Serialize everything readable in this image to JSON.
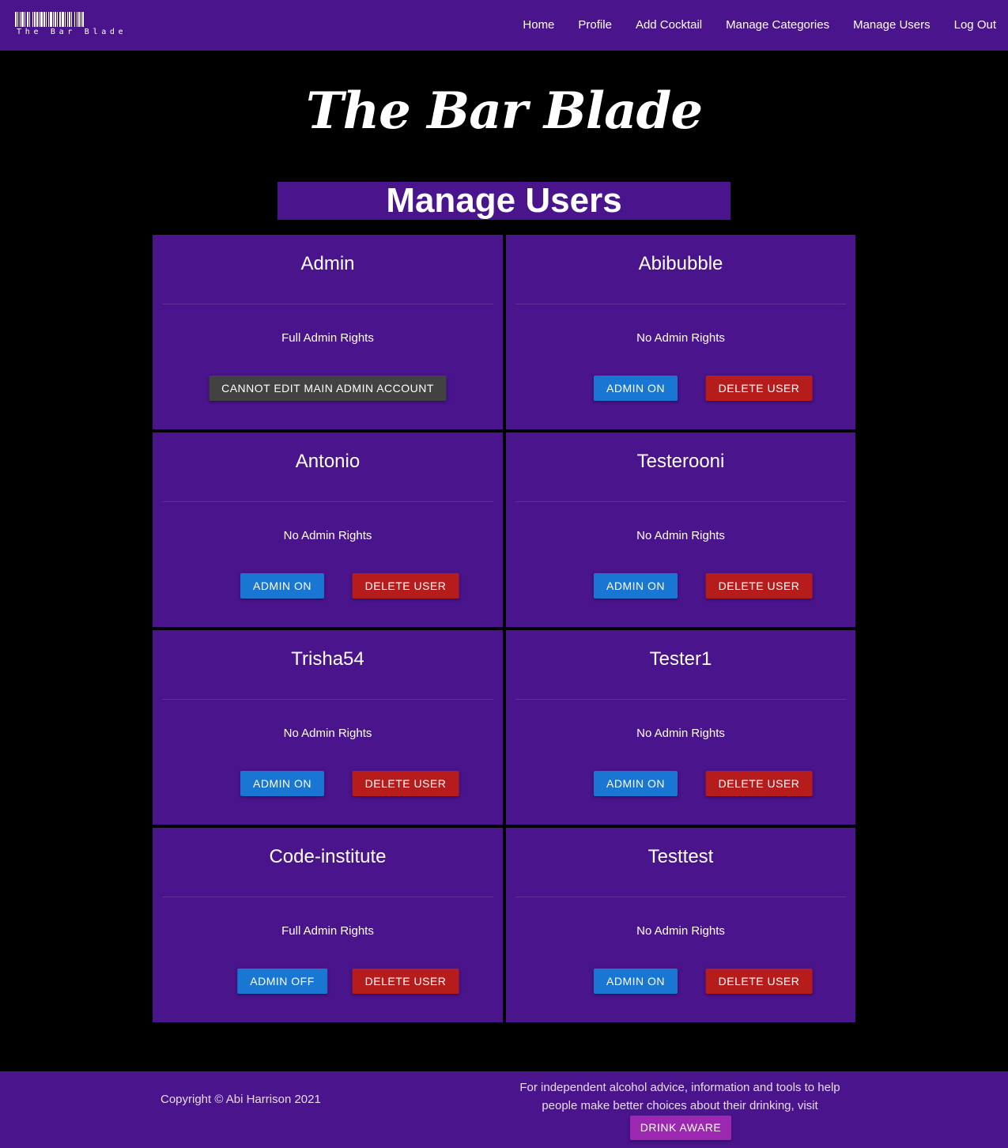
{
  "navbar": {
    "logo_text": "The Bar Blade",
    "links": [
      {
        "label": "Home"
      },
      {
        "label": "Profile"
      },
      {
        "label": "Add Cocktail"
      },
      {
        "label": "Manage Categories"
      },
      {
        "label": "Manage Users"
      },
      {
        "label": "Log Out"
      }
    ]
  },
  "header": {
    "site_title": "The Bar Blade",
    "page_heading": "Manage Users"
  },
  "users": [
    {
      "name": "Admin",
      "rights": "Full Admin Rights",
      "buttons": [
        {
          "label": "CANNOT EDIT MAIN ADMIN ACCOUNT",
          "kind": "grey"
        }
      ]
    },
    {
      "name": "Abibubble",
      "rights": "No Admin Rights",
      "buttons": [
        {
          "label": "ADMIN ON",
          "kind": "blue"
        },
        {
          "label": "DELETE USER",
          "kind": "red"
        }
      ]
    },
    {
      "name": "Antonio",
      "rights": "No Admin Rights",
      "buttons": [
        {
          "label": "ADMIN ON",
          "kind": "blue"
        },
        {
          "label": "DELETE USER",
          "kind": "red"
        }
      ]
    },
    {
      "name": "Testerooni",
      "rights": "No Admin Rights",
      "buttons": [
        {
          "label": "ADMIN ON",
          "kind": "blue"
        },
        {
          "label": "DELETE USER",
          "kind": "red"
        }
      ]
    },
    {
      "name": "Trisha54",
      "rights": "No Admin Rights",
      "buttons": [
        {
          "label": "ADMIN ON",
          "kind": "blue"
        },
        {
          "label": "DELETE USER",
          "kind": "red"
        }
      ]
    },
    {
      "name": "Tester1",
      "rights": "No Admin Rights",
      "buttons": [
        {
          "label": "ADMIN ON",
          "kind": "blue"
        },
        {
          "label": "DELETE USER",
          "kind": "red"
        }
      ]
    },
    {
      "name": "Code-institute",
      "rights": "Full Admin Rights",
      "buttons": [
        {
          "label": "ADMIN OFF",
          "kind": "blue"
        },
        {
          "label": "DELETE USER",
          "kind": "red"
        }
      ]
    },
    {
      "name": "Testtest",
      "rights": "No Admin Rights",
      "buttons": [
        {
          "label": "ADMIN ON",
          "kind": "blue"
        },
        {
          "label": "DELETE USER",
          "kind": "red"
        }
      ]
    }
  ],
  "footer": {
    "copyright": "Copyright © Abi Harrison 2021",
    "advice_text": "For independent alcohol advice, information and tools to help people make better choices about their drinking, visit",
    "drink_aware_label": "DRINK AWARE"
  },
  "colors": {
    "brand_purple": "#4a148c",
    "background": "#000000",
    "button_blue": "#1976d2",
    "button_red": "#b71c1c",
    "button_grey": "#424242",
    "drink_aware_purple": "#9c27b0"
  },
  "icons": {
    "logo": "barcode-logo-icon"
  }
}
